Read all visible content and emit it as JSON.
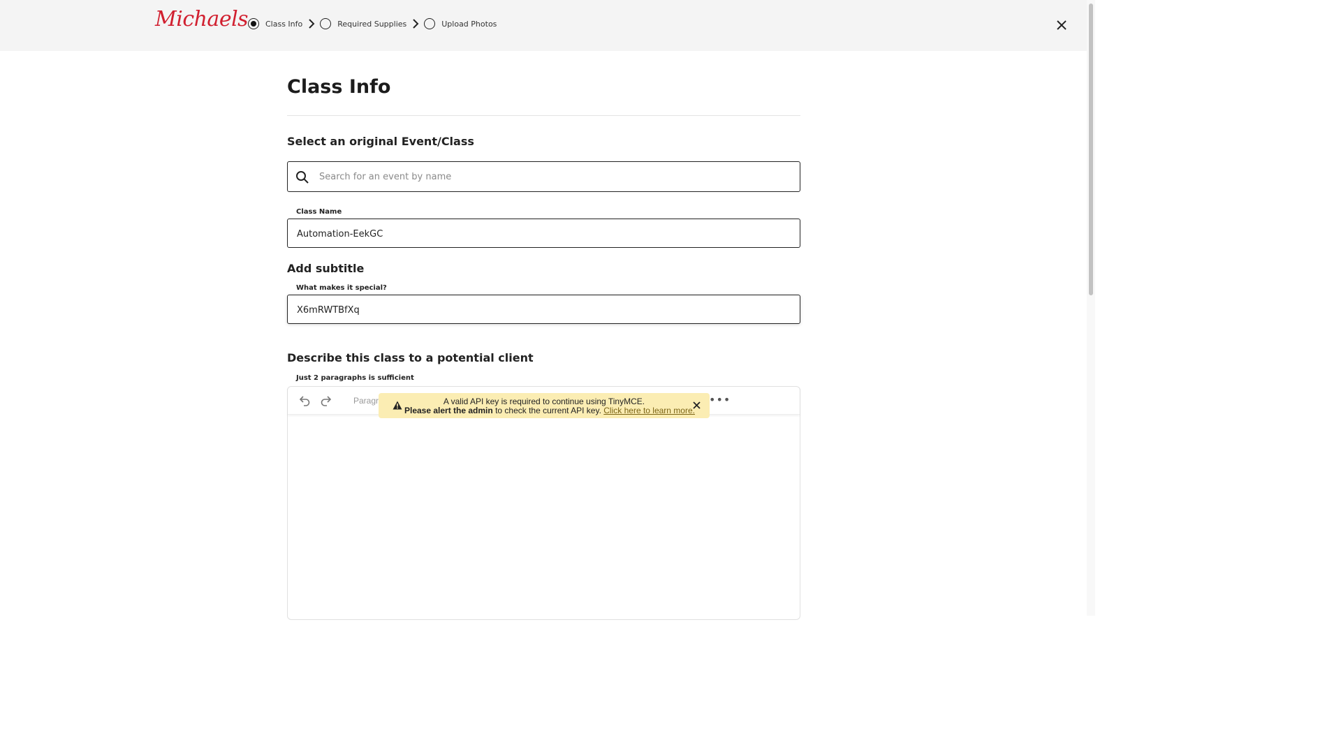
{
  "header": {
    "logo_text": "Michaels",
    "steps": [
      {
        "label": "Class Info",
        "active": true
      },
      {
        "label": "Required Supplies",
        "active": false
      },
      {
        "label": "Upload Photos",
        "active": false
      }
    ]
  },
  "page": {
    "title": "Class Info",
    "event_section": {
      "heading": "Select an original Event/Class",
      "search_placeholder": "Search for an event by name",
      "search_value": ""
    },
    "class_name": {
      "label": "Class Name",
      "value": "Automation-EekGC"
    },
    "subtitle_section": {
      "heading": "Add subtitle",
      "label": "What makes it special?",
      "value": "X6mRWTBfXq"
    },
    "description_section": {
      "heading": "Describe this class to a potential client",
      "label": "Just 2 paragraphs is sufficient",
      "toolbar": {
        "paragraph_label": "Paragra",
        "more_label": "•••"
      }
    }
  },
  "notice": {
    "line1": "A valid API key is required to continue using TinyMCE.",
    "line2_bold": "Please alert the admin",
    "line2_text": " to check the current API key. ",
    "link_text": "Click here to learn more."
  },
  "colors": {
    "brand": "#d11f2f",
    "notice_bg": "#fbedb3",
    "header_bg": "#f4f4f4"
  },
  "icons": [
    "close-icon",
    "chevron-right-icon",
    "search-icon",
    "undo-icon",
    "redo-icon",
    "warning-icon"
  ]
}
